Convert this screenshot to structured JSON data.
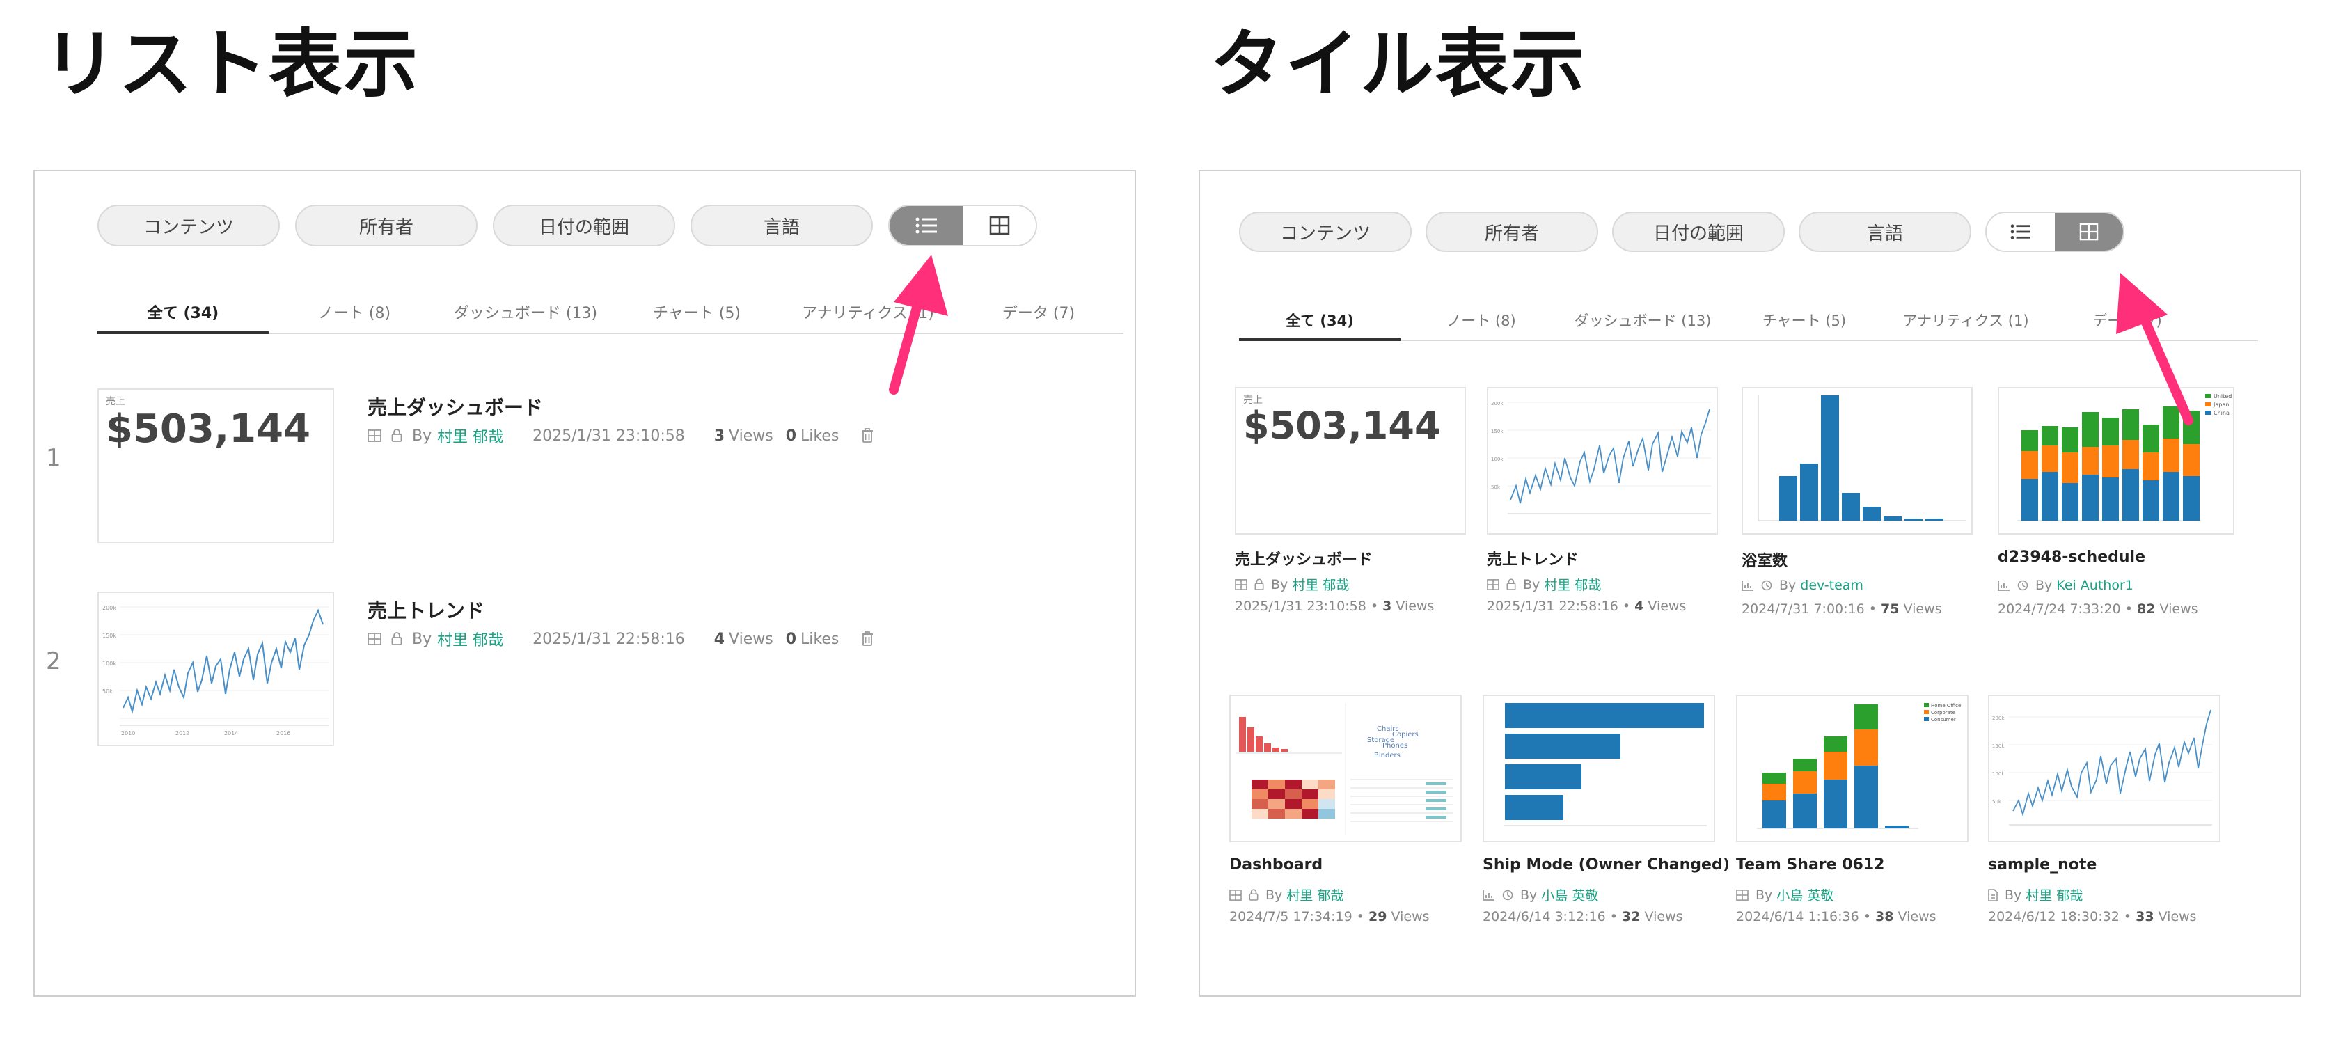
{
  "headings": {
    "left": "リスト表示",
    "right": "タイル表示"
  },
  "filters": [
    "コンテンツ",
    "所有者",
    "日付の範囲",
    "言語"
  ],
  "tabs": [
    "全て (34)",
    "ノート (8)",
    "ダッシュボード (13)",
    "チャート (5)",
    "アナリティクス (1)",
    "データ (7)"
  ],
  "colors": {
    "accent": "#ff2f7a",
    "author": "#1aa385",
    "bar_blue": "#1f77b4",
    "bar_orange": "#ff7f0e",
    "bar_green": "#2ca02c"
  },
  "list": {
    "items": [
      {
        "num": "1",
        "title": "売上ダッシュボード",
        "by": "By",
        "author": "村里 郁哉",
        "date": "2025/1/31 23:10:58",
        "views": "3",
        "views_label": "Views",
        "likes": "0",
        "likes_label": "Likes",
        "kpi_label": "売上",
        "kpi_value": "$503,144"
      },
      {
        "num": "2",
        "title": "売上トレンド",
        "by": "By",
        "author": "村里 郁哉",
        "date": "2025/1/31 22:58:16",
        "views": "4",
        "views_label": "Views",
        "likes": "0",
        "likes_label": "Likes"
      }
    ]
  },
  "tiles": {
    "cards": [
      {
        "title": "売上ダッシュボード",
        "author": "村里 郁哉",
        "date": "2025/1/31 23:10:58",
        "views": "3",
        "kpi_label": "売上",
        "kpi_value": "$503,144"
      },
      {
        "title": "売上トレンド",
        "author": "村里 郁哉",
        "date": "2025/1/31 22:58:16",
        "views": "4"
      },
      {
        "title": "浴室数",
        "author": "dev-team",
        "date": "2024/7/31 7:00:16",
        "views": "75"
      },
      {
        "title": "d23948-schedule",
        "author": "Kei Author1",
        "date": "2024/7/24 7:33:20",
        "views": "82"
      },
      {
        "title": "Dashboard",
        "author": "村里 郁哉",
        "date": "2024/7/5 17:34:19",
        "views": "29"
      },
      {
        "title": "Ship Mode (Owner Changed)",
        "author": "小島 英敬",
        "date": "2024/6/14 3:12:16",
        "views": "32"
      },
      {
        "title": "Team Share 0612",
        "author": "小島 英敬",
        "date": "2024/6/14 1:16:36",
        "views": "38"
      },
      {
        "title": "sample_note",
        "author": "村里 郁哉",
        "date": "2024/6/12 18:30:32",
        "views": "33"
      }
    ],
    "by_label": "By",
    "views_label": "Views"
  },
  "icons": {
    "list_view": "list-icon",
    "grid_view": "grid-icon",
    "dashboard": "dashboard-icon",
    "lock": "lock-icon",
    "delete": "trash-icon",
    "chart": "chart-icon",
    "clock": "clock-icon",
    "note": "note-icon",
    "annotation": "arrow-icon"
  }
}
